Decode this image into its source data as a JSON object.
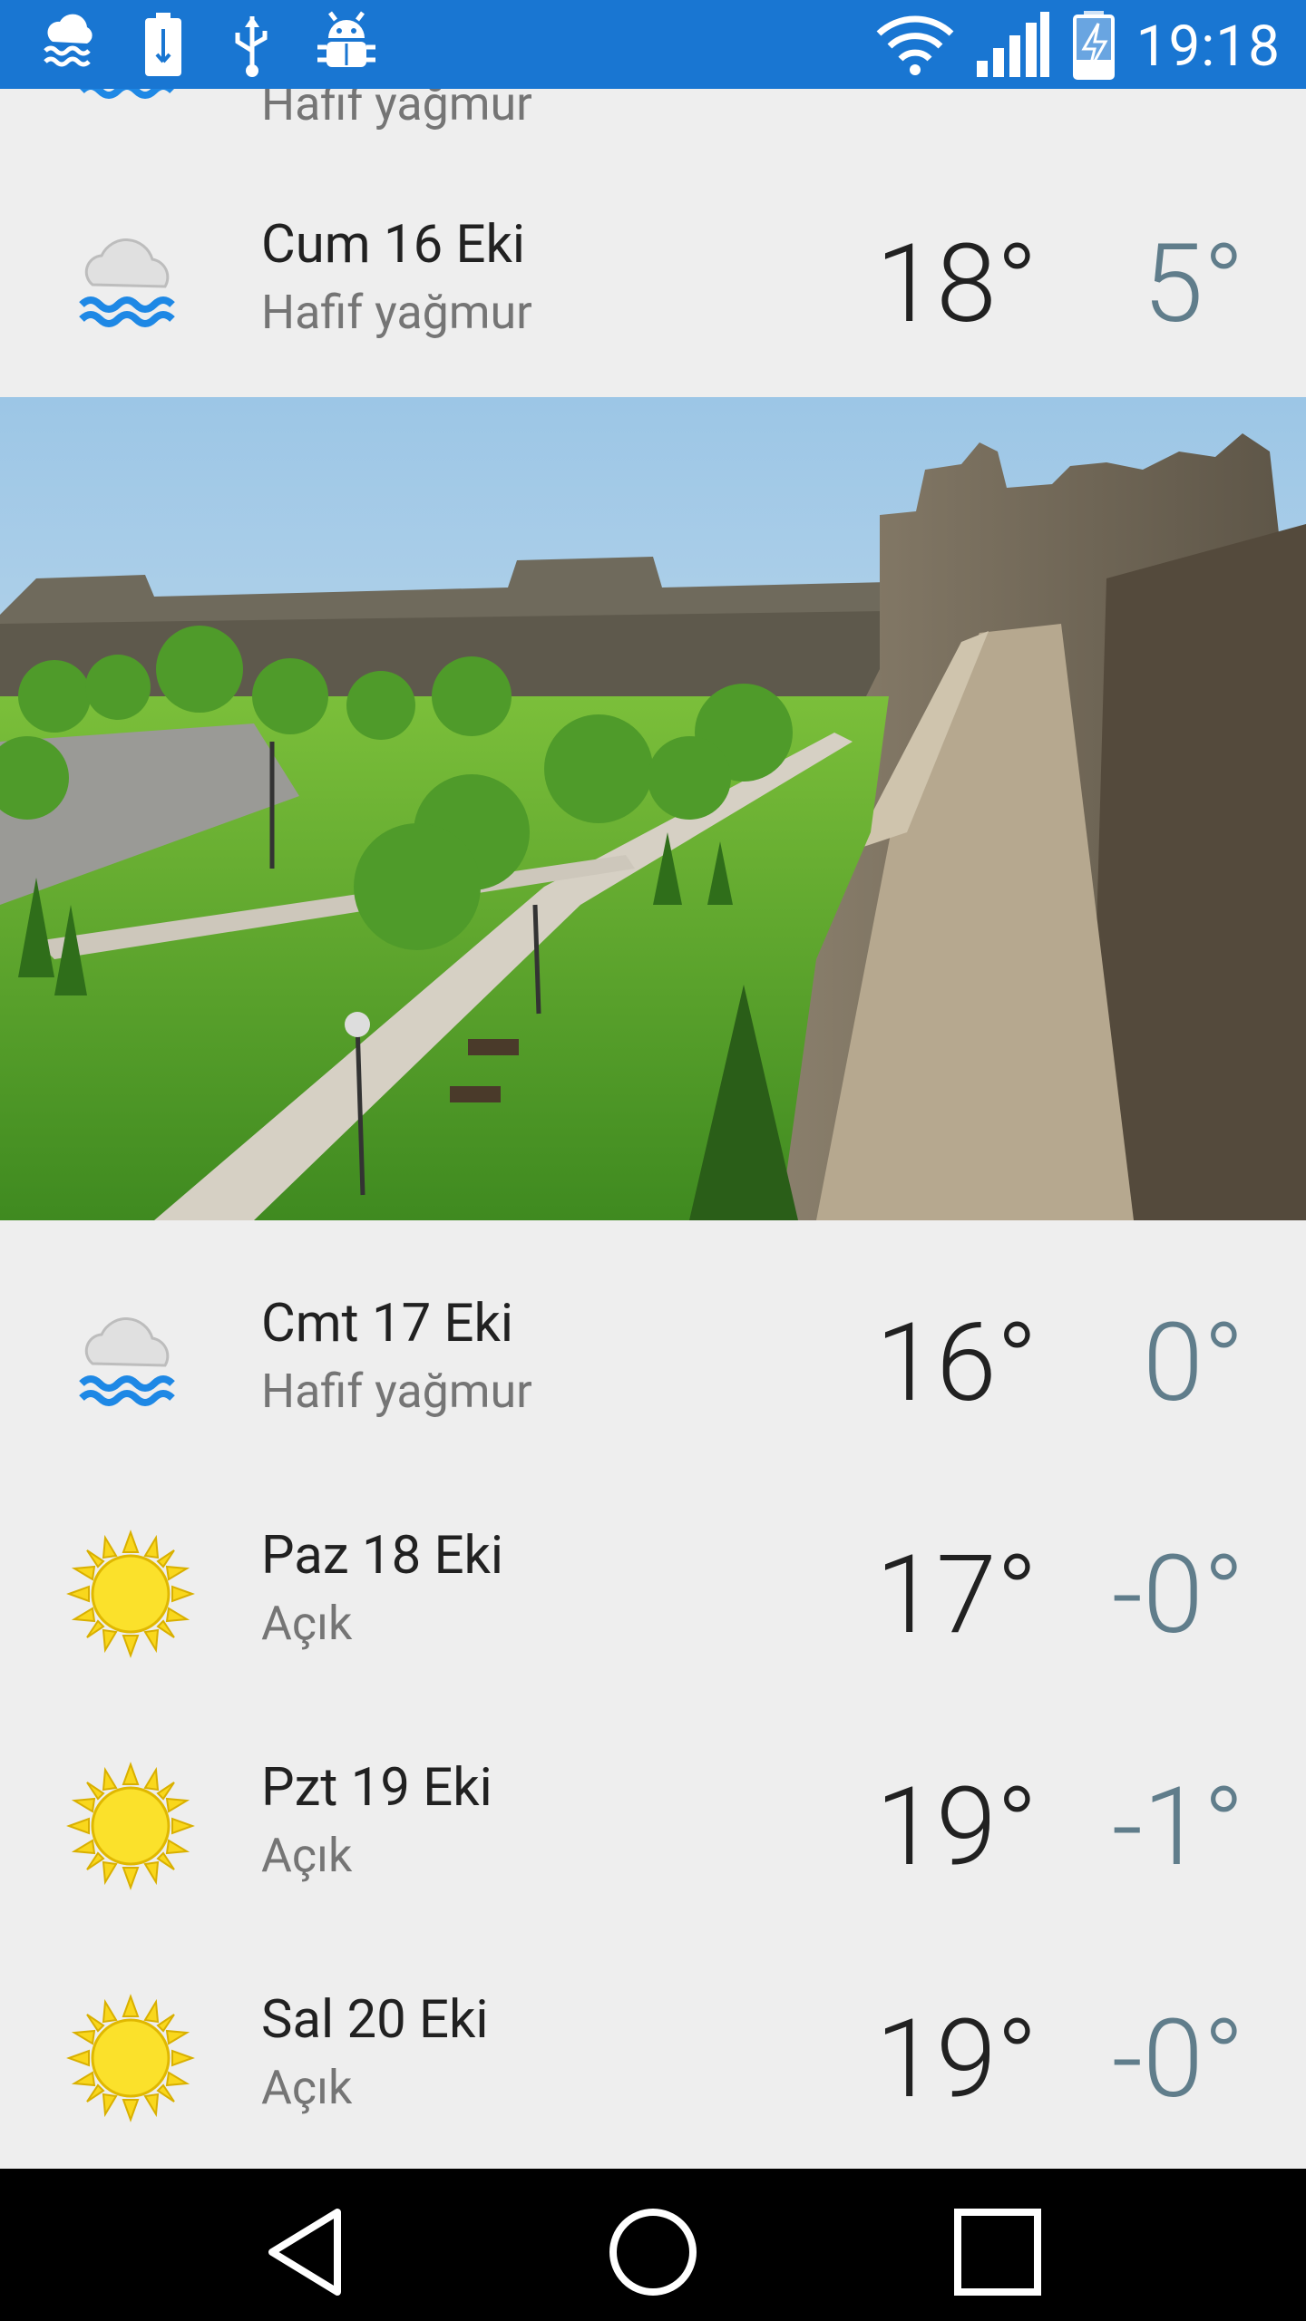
{
  "status_bar": {
    "time": "19:18",
    "left_icons": [
      "weather-rain-icon",
      "battery-usb-icon",
      "usb-icon",
      "android-debug-icon"
    ],
    "right_icons": [
      "wifi-icon",
      "cellular-signal-icon",
      "battery-charging-icon"
    ]
  },
  "forecast_top_partial": {
    "desc": "Hafif yağmur"
  },
  "forecast": [
    {
      "day": "Cum 16 Eki",
      "desc": "Hafif yağmur",
      "hi": "18°",
      "lo": "5°",
      "icon": "rain-cloud-icon"
    },
    {
      "day": "Cmt 17 Eki",
      "desc": "Hafif yağmur",
      "hi": "16°",
      "lo": "0°",
      "icon": "rain-cloud-icon"
    },
    {
      "day": "Paz 18 Eki",
      "desc": "Açık",
      "hi": "17°",
      "lo": "-0°",
      "icon": "sun-icon"
    },
    {
      "day": "Pzt 19 Eki",
      "desc": "Açık",
      "hi": "19°",
      "lo": "-1°",
      "icon": "sun-icon"
    },
    {
      "day": "Sal 20 Eki",
      "desc": "Açık",
      "hi": "19°",
      "lo": "-0°",
      "icon": "sun-icon"
    }
  ],
  "photo": {
    "subject": "city-walls-park-photo"
  },
  "nav": [
    "back-button",
    "home-button",
    "recents-button"
  ],
  "colors": {
    "status_bar": "#1976d2",
    "low_temp": "#607d8b",
    "background": "#eeeeee"
  }
}
